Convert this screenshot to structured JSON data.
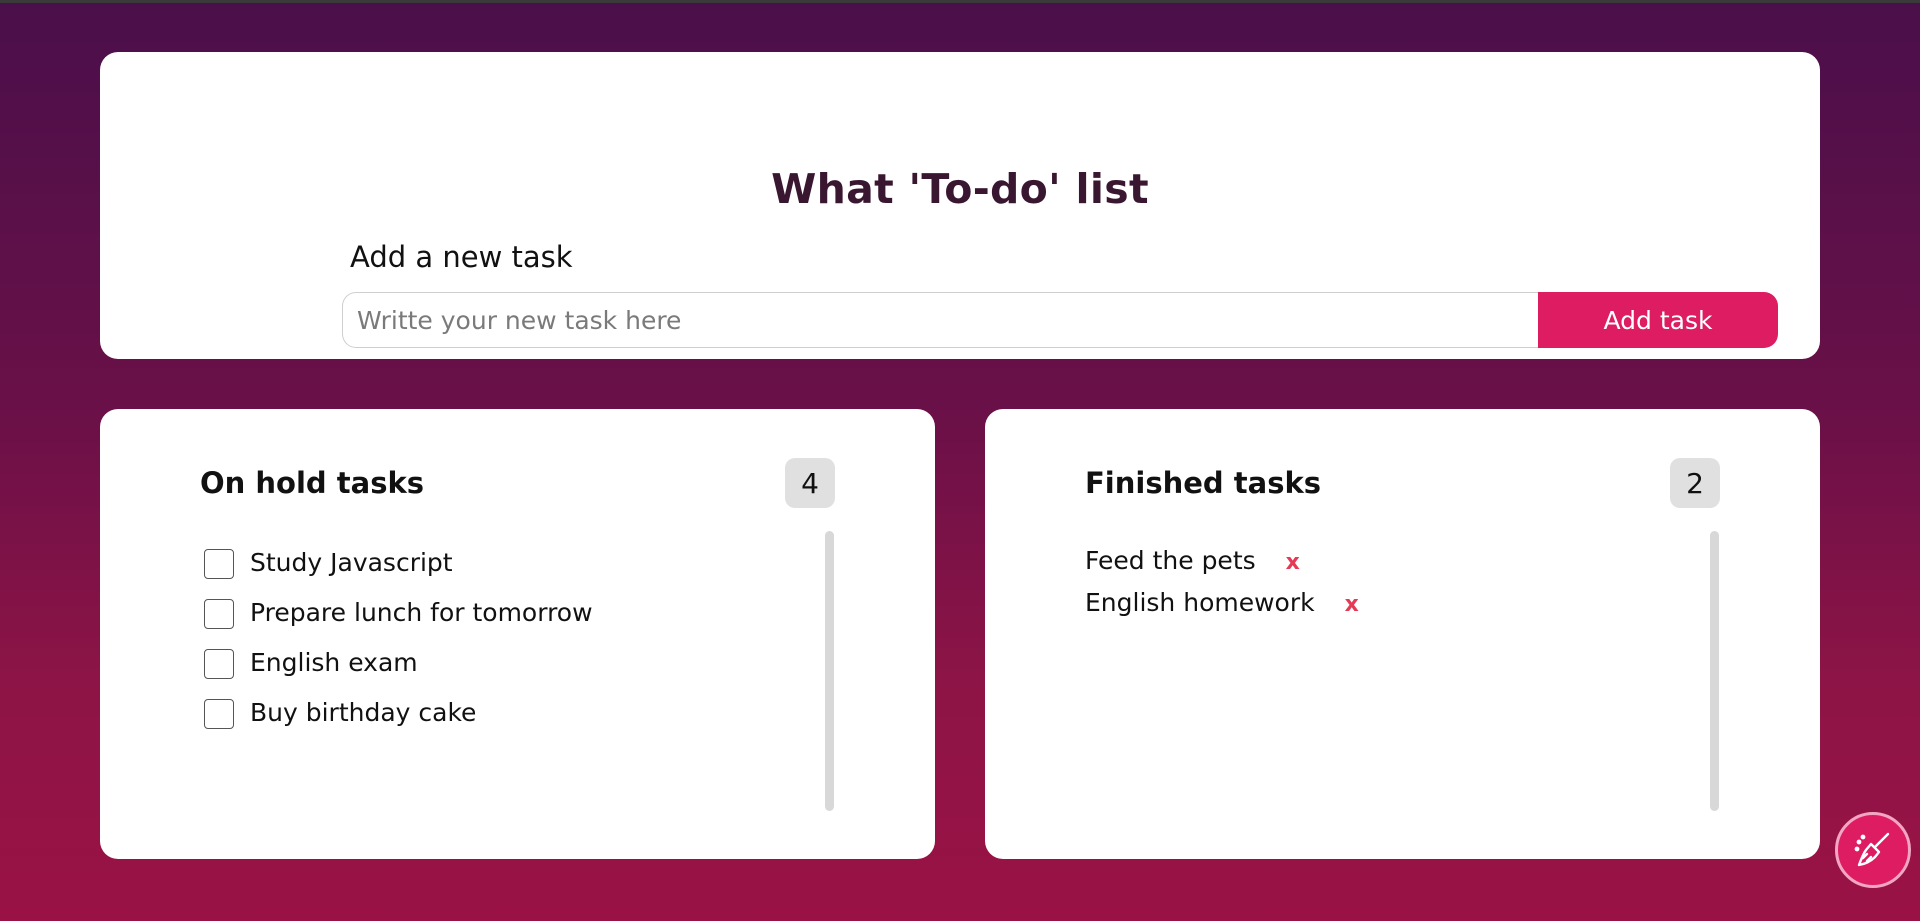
{
  "header": {
    "title": "What 'To-do' list",
    "add_label": "Add a new task",
    "input_placeholder": "Writte your new task here",
    "input_value": "",
    "add_button_label": "Add task"
  },
  "on_hold": {
    "title": "On hold tasks",
    "count": "4",
    "items": [
      {
        "label": "Study Javascript",
        "checked": false
      },
      {
        "label": "Prepare lunch for tomorrow",
        "checked": false
      },
      {
        "label": "English exam",
        "checked": false
      },
      {
        "label": "Buy birthday cake",
        "checked": false
      }
    ]
  },
  "finished": {
    "title": "Finished tasks",
    "count": "2",
    "items": [
      {
        "label": "Feed the pets",
        "delete": "x"
      },
      {
        "label": "English homework",
        "delete": "x"
      }
    ]
  },
  "fab": {
    "icon": "broom-icon"
  },
  "colors": {
    "accent": "#dd1c62",
    "delete": "#e53a55",
    "title": "#3a1730",
    "background_top": "#4a0f4a",
    "background_bottom": "#9a1245"
  }
}
